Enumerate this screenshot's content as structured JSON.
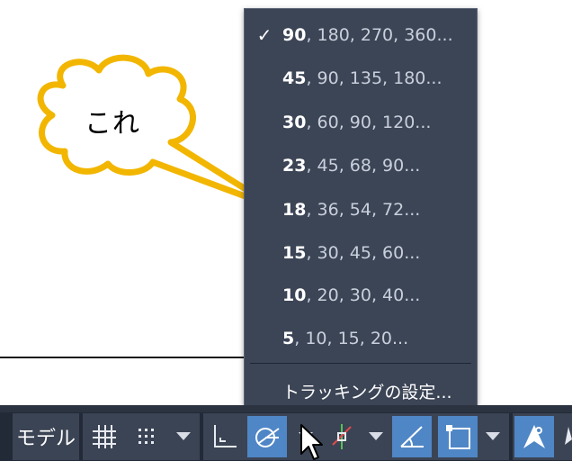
{
  "callout": {
    "text": "これ"
  },
  "menu": {
    "items": [
      {
        "bold": "90",
        "rest": ", 180, 270, 360...",
        "checked": true
      },
      {
        "bold": "45",
        "rest": ", 90, 135, 180...",
        "checked": false
      },
      {
        "bold": "30",
        "rest": ", 60, 90, 120...",
        "checked": false
      },
      {
        "bold": "23",
        "rest": ", 45, 68, 90...",
        "checked": false
      },
      {
        "bold": "18",
        "rest": ", 36, 54, 72...",
        "checked": false
      },
      {
        "bold": "15",
        "rest": ", 30, 45, 60...",
        "checked": false
      },
      {
        "bold": "10",
        "rest": ", 20, 30, 40...",
        "checked": false
      },
      {
        "bold": "5",
        "rest": ", 10, 15, 20...",
        "checked": false
      }
    ],
    "check_mark": "✓",
    "settings_label": "トラッキングの設定..."
  },
  "statusbar": {
    "model_label": "モデル",
    "icons": [
      "grid-icon",
      "snap-dots-icon",
      "ortho-icon",
      "polar-tracking-icon",
      "osnap-tracking-icon",
      "dynamic-ucs-angle-icon",
      "selection-cycling-icon",
      "annotation-icon"
    ]
  },
  "colors": {
    "menu_bg": "#3c4556",
    "accent": "#4f86c6",
    "callout_border": "#f2b600"
  }
}
